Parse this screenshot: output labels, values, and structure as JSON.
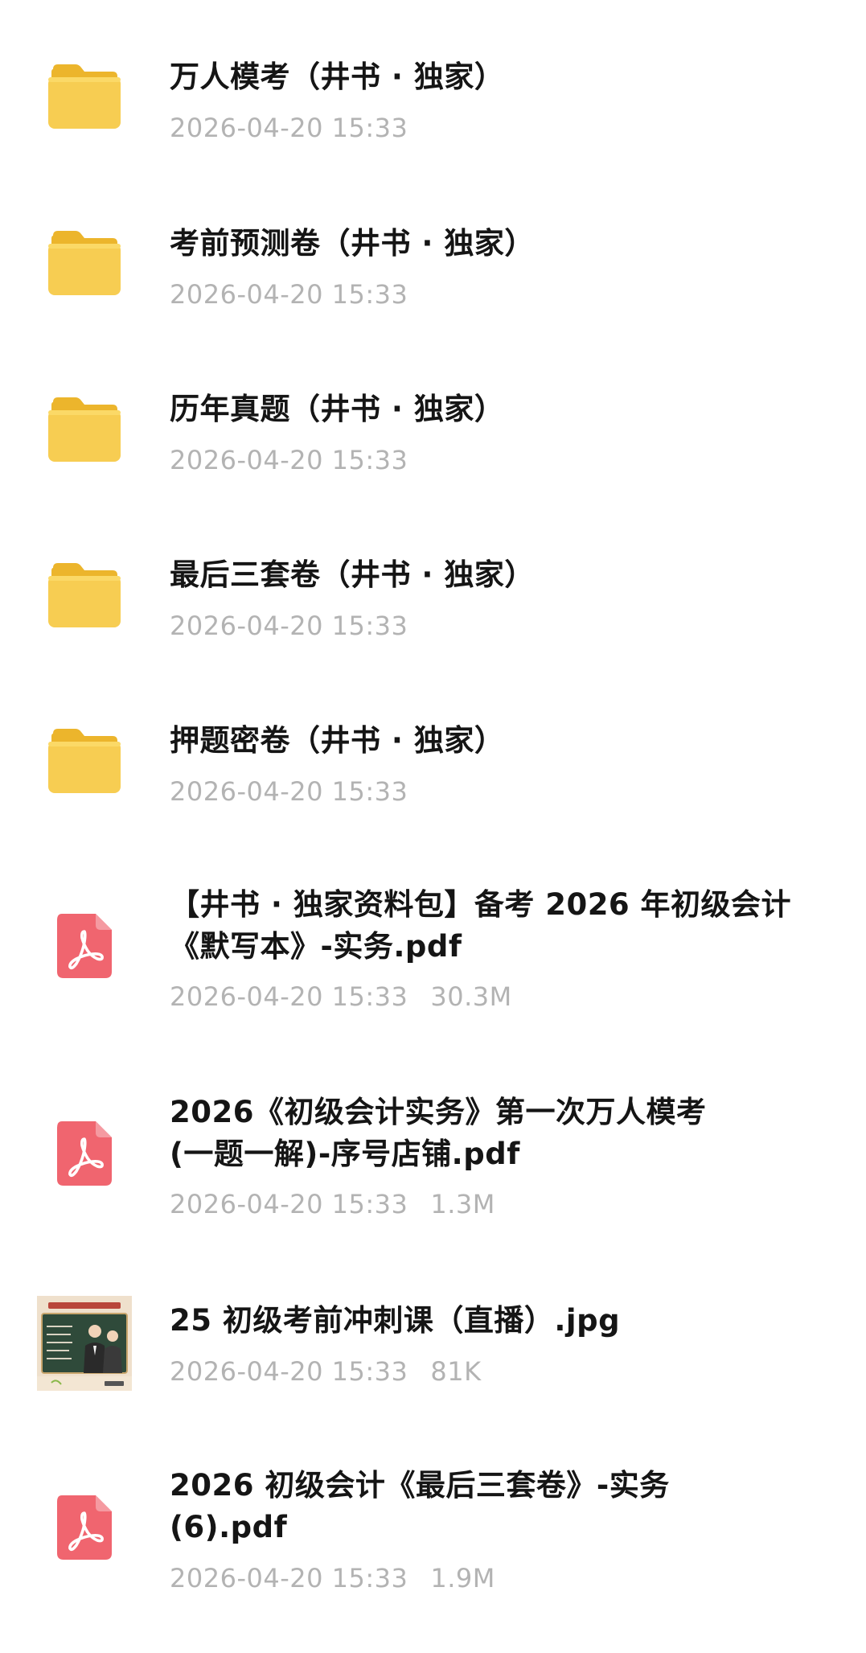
{
  "files": [
    {
      "name": "万人模考（井书 · 独家）",
      "date": "2026-04-20 15:33",
      "size": "",
      "icon": "folder-icon"
    },
    {
      "name": "考前预测卷（井书 · 独家）",
      "date": "2026-04-20 15:33",
      "size": "",
      "icon": "folder-icon"
    },
    {
      "name": "历年真题（井书 · 独家）",
      "date": "2026-04-20 15:33",
      "size": "",
      "icon": "folder-icon"
    },
    {
      "name": "最后三套卷（井书 · 独家）",
      "date": "2026-04-20 15:33",
      "size": "",
      "icon": "folder-icon"
    },
    {
      "name": "押题密卷（井书 · 独家）",
      "date": "2026-04-20 15:33",
      "size": "",
      "icon": "folder-icon"
    },
    {
      "name": "【井书 · 独家资料包】备考 2026 年初级会计\n《默写本》-实务.pdf",
      "date": "2026-04-20 15:33",
      "size": "30.3M",
      "icon": "pdf-icon"
    },
    {
      "name": "2026《初级会计实务》第一次万人模考\n(一题一解)-序号店铺.pdf",
      "date": "2026-04-20 15:33",
      "size": "1.3M",
      "icon": "pdf-icon"
    },
    {
      "name": "25 初级考前冲刺课（直播）.jpg",
      "date": "2026-04-20 15:33",
      "size": "81K",
      "icon": "image-thumbnail-icon"
    },
    {
      "name": "2026 初级会计《最后三套卷》-实务\n(6).pdf",
      "date": "2026-04-20 15:33",
      "size": "1.9M",
      "icon": "pdf-icon"
    }
  ],
  "colors": {
    "folder": "#f5c542",
    "pdf": "#f0656f",
    "name_text": "#151515",
    "meta_text": "#b3b3b3"
  }
}
